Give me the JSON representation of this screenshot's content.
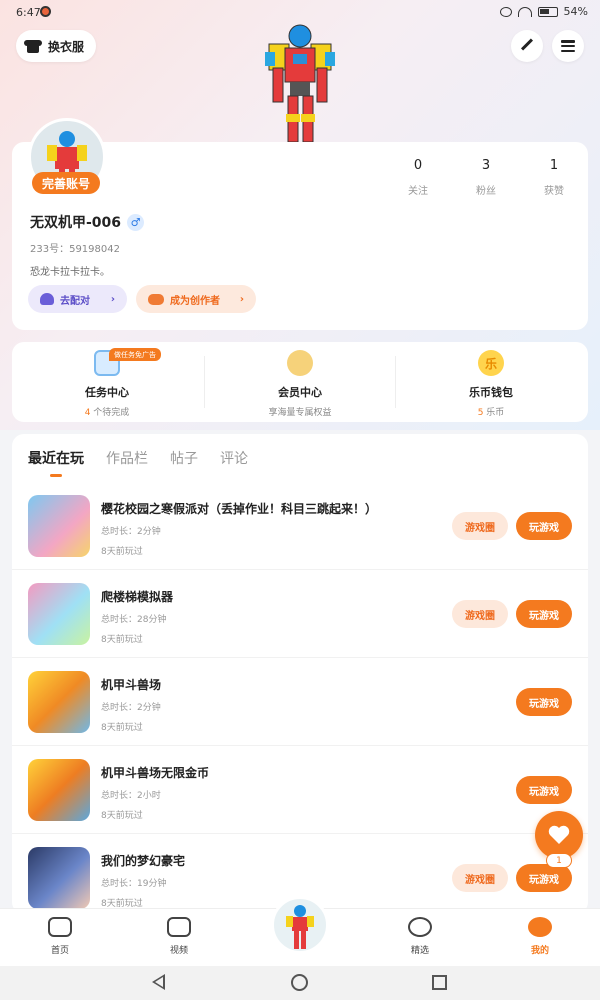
{
  "status_bar": {
    "time": "6:47",
    "battery": "54%"
  },
  "header": {
    "outfit_label": "换衣服"
  },
  "profile": {
    "badge": "完善账号",
    "stats": [
      {
        "value": "0",
        "label": "关注"
      },
      {
        "value": "3",
        "label": "粉丝"
      },
      {
        "value": "1",
        "label": "获赞"
      }
    ],
    "username": "无双机甲-006",
    "gender_symbol": "♂",
    "uid": "233号：59198042",
    "bio": "恐龙卡拉卡拉卡。",
    "pair_label": "去配对",
    "creator_label": "成为创作者"
  },
  "quick_entries": {
    "ad_tag": "做任务免广告",
    "items": [
      {
        "title": "任务中心",
        "count": "4",
        "sub": "个待完成"
      },
      {
        "title": "会员中心",
        "sub": "享海量专属权益"
      },
      {
        "title": "乐币钱包",
        "count": "5",
        "sub": "乐币",
        "icon_text": "乐"
      }
    ]
  },
  "tabs": [
    "最近在玩",
    "作品栏",
    "帖子",
    "评论"
  ],
  "games": [
    {
      "title": "樱花校园之寒假派对（丢掉作业！科目三跳起来！）",
      "duration": "总时长：2分钟",
      "ago": "8天前玩过",
      "circle": "游戏圈",
      "play": "玩游戏"
    },
    {
      "title": "爬楼梯模拟器",
      "duration": "总时长：28分钟",
      "ago": "8天前玩过",
      "circle": "游戏圈",
      "play": "玩游戏"
    },
    {
      "title": "机甲斗兽场",
      "duration": "总时长：2分钟",
      "ago": "8天前玩过",
      "play": "玩游戏"
    },
    {
      "title": "机甲斗兽场无限金币",
      "duration": "总时长：2小时",
      "ago": "8天前玩过",
      "play": "玩游戏"
    },
    {
      "title": "我们的梦幻豪宅",
      "duration": "总时长：19分钟",
      "ago": "8天前玩过",
      "circle": "游戏圈",
      "play": "玩游戏"
    }
  ],
  "fab": {
    "count": "1"
  },
  "bottom_nav": [
    {
      "label": "首页"
    },
    {
      "label": "视频"
    },
    {
      "label": "精选"
    },
    {
      "label": "我的"
    }
  ]
}
